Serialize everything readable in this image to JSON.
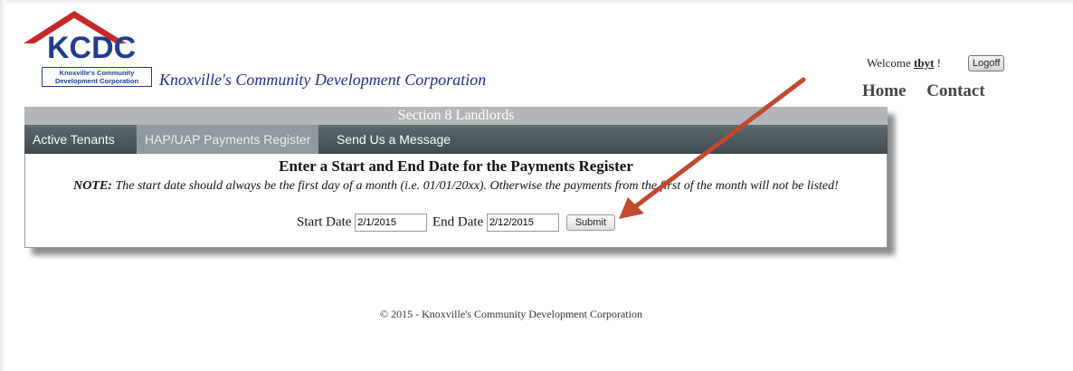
{
  "brand": {
    "logo_text": "KCDC",
    "logo_subtitle_line1": "Knoxville's Community",
    "logo_subtitle_line2": "Development Corporation",
    "site_title": "Knoxville's Community Development Corporation",
    "roof_color": "#c62828",
    "brand_color": "#1f3d8f"
  },
  "user": {
    "welcome_label": "Welcome",
    "username": "tbyt",
    "suffix": "!",
    "logoff_label": "Logoff"
  },
  "top_nav": [
    {
      "label": "Home"
    },
    {
      "label": "Contact"
    }
  ],
  "panel": {
    "header": "Section 8 Landlords",
    "tabs": [
      {
        "label": "Active Tenants",
        "active": false
      },
      {
        "label": "HAP/UAP Payments Register",
        "active": true
      },
      {
        "label": "Send Us a Message",
        "active": false
      }
    ],
    "title": "Enter a Start and End Date for the Payments Register",
    "note_label": "NOTE:",
    "note_text": "The start date should always be the first day of a month (i.e. 01/01/20xx). Otherwise the payments from the first of the month will not be listed!",
    "start_label": "Start Date",
    "start_value": "2/1/2015",
    "end_label": "End Date",
    "end_value": "2/12/2015",
    "submit_label": "Submit"
  },
  "footer": "© 2015 - Knoxville's Community Development Corporation",
  "annotation": {
    "arrow_color": "#c0492f"
  }
}
